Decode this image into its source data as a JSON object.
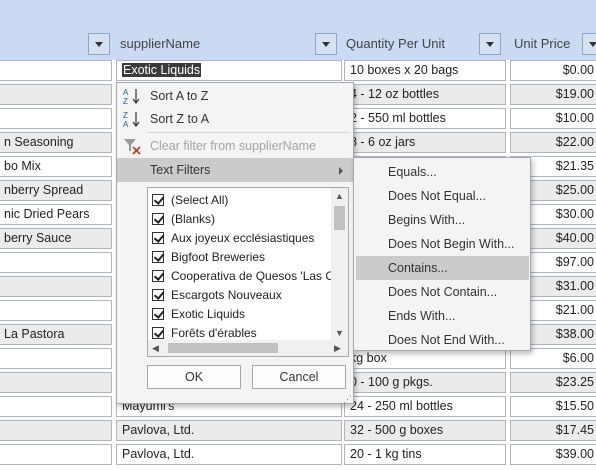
{
  "columns": [
    {
      "title": ""
    },
    {
      "title": "supplierName"
    },
    {
      "title": "Quantity Per Unit"
    },
    {
      "title": "Unit Price"
    }
  ],
  "rows": [
    {
      "product": "",
      "supplier": "Exotic Liquids",
      "qty": "10 boxes x 20 bags",
      "price": "$0.00"
    },
    {
      "product": "",
      "supplier": "",
      "qty": "4 - 12 oz bottles",
      "price": "$19.00"
    },
    {
      "product": "",
      "supplier": "",
      "qty": "2 - 550 ml bottles",
      "price": "$10.00"
    },
    {
      "product": "n Seasoning",
      "supplier": "",
      "qty": "8 - 6 oz jars",
      "price": "$22.00"
    },
    {
      "product": "bo Mix",
      "supplier": "",
      "qty": "",
      "price": "$21.35"
    },
    {
      "product": "nberry Spread",
      "supplier": "",
      "qty": "",
      "price": "$25.00"
    },
    {
      "product": "nic Dried Pears",
      "supplier": "",
      "qty": "",
      "price": "$30.00"
    },
    {
      "product": "berry Sauce",
      "supplier": "",
      "qty": "",
      "price": "$40.00"
    },
    {
      "product": "",
      "supplier": "",
      "qty": "",
      "price": "$97.00"
    },
    {
      "product": "",
      "supplier": "",
      "qty": "",
      "price": "$31.00"
    },
    {
      "product": "",
      "supplier": "",
      "qty": "",
      "price": "$21.00"
    },
    {
      "product": " La Pastora",
      "supplier": "",
      "qty": "",
      "price": "$38.00"
    },
    {
      "product": "",
      "supplier": "",
      "qty": " kg box",
      "price": "$6.00"
    },
    {
      "product": "",
      "supplier": "",
      "qty": "0 - 100 g pkgs.",
      "price": "$23.25"
    },
    {
      "product": "",
      "supplier": "Mayumi's",
      "qty": "24 - 250 ml bottles",
      "price": "$15.50"
    },
    {
      "product": "",
      "supplier": "Pavlova, Ltd.",
      "qty": "32 - 500 g boxes",
      "price": "$17.45"
    },
    {
      "product": "",
      "supplier": "Pavlova, Ltd.",
      "qty": "20 - 1 kg tins",
      "price": "$39.00"
    }
  ],
  "filter_menu": {
    "sort_asc": "Sort A to Z",
    "sort_desc": "Sort Z to A",
    "clear_filter": "Clear filter from supplierName",
    "text_filters": "Text Filters",
    "list_items": [
      "(Select All)",
      "(Blanks)",
      "Aux joyeux ecclésiastiques",
      "Bigfoot Breweries",
      "Cooperativa de Quesos 'Las Cabras'",
      "Escargots Nouveaux",
      "Exotic Liquids",
      "Forêts d'érables"
    ],
    "ok_label": "OK",
    "cancel_label": "Cancel"
  },
  "text_filters_submenu": {
    "items": [
      "Equals...",
      "Does Not Equal...",
      "Begins With...",
      "Does Not Begin With...",
      "Contains...",
      "Does Not Contain...",
      "Ends With...",
      "Does Not End With..."
    ],
    "active_item": "Contains..."
  },
  "colors": {
    "header_bg": "#c9daf2",
    "menu_bg": "#f4f4f4",
    "highlight": "#cbcbcb",
    "selection": "#3b3b3b"
  }
}
